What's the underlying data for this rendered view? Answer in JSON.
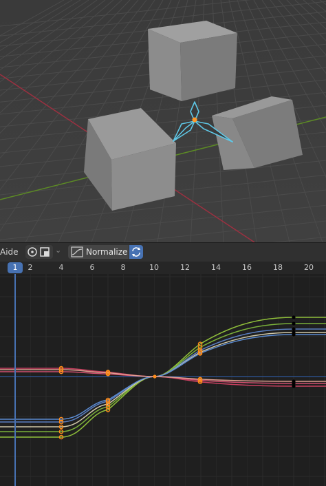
{
  "graph_editor": {
    "menu_fragment": "Aide",
    "normalize_label": "Normalize",
    "current_frame": "1",
    "frame_labels": [
      "2",
      "4",
      "6",
      "8",
      "10",
      "12",
      "14",
      "16",
      "18",
      "20"
    ]
  },
  "colors": {
    "viewport_bg": "#3d3d3d",
    "graph_bg": "#1f1f1f",
    "playhead": "#4772b3",
    "x_axis": "#b33a47",
    "y_axis": "#6c9a28",
    "armature_select": "#5fc7e6",
    "keyframe_selected": "#ff8c1a",
    "keyframe_unselected": "#000000"
  },
  "icons": {
    "pivot": "pivot-point-icon",
    "snap": "snap-icon",
    "chevron": "chevron-down-icon",
    "normalize": "normalize-curve-icon",
    "auto_normalize": "refresh-icon"
  }
}
